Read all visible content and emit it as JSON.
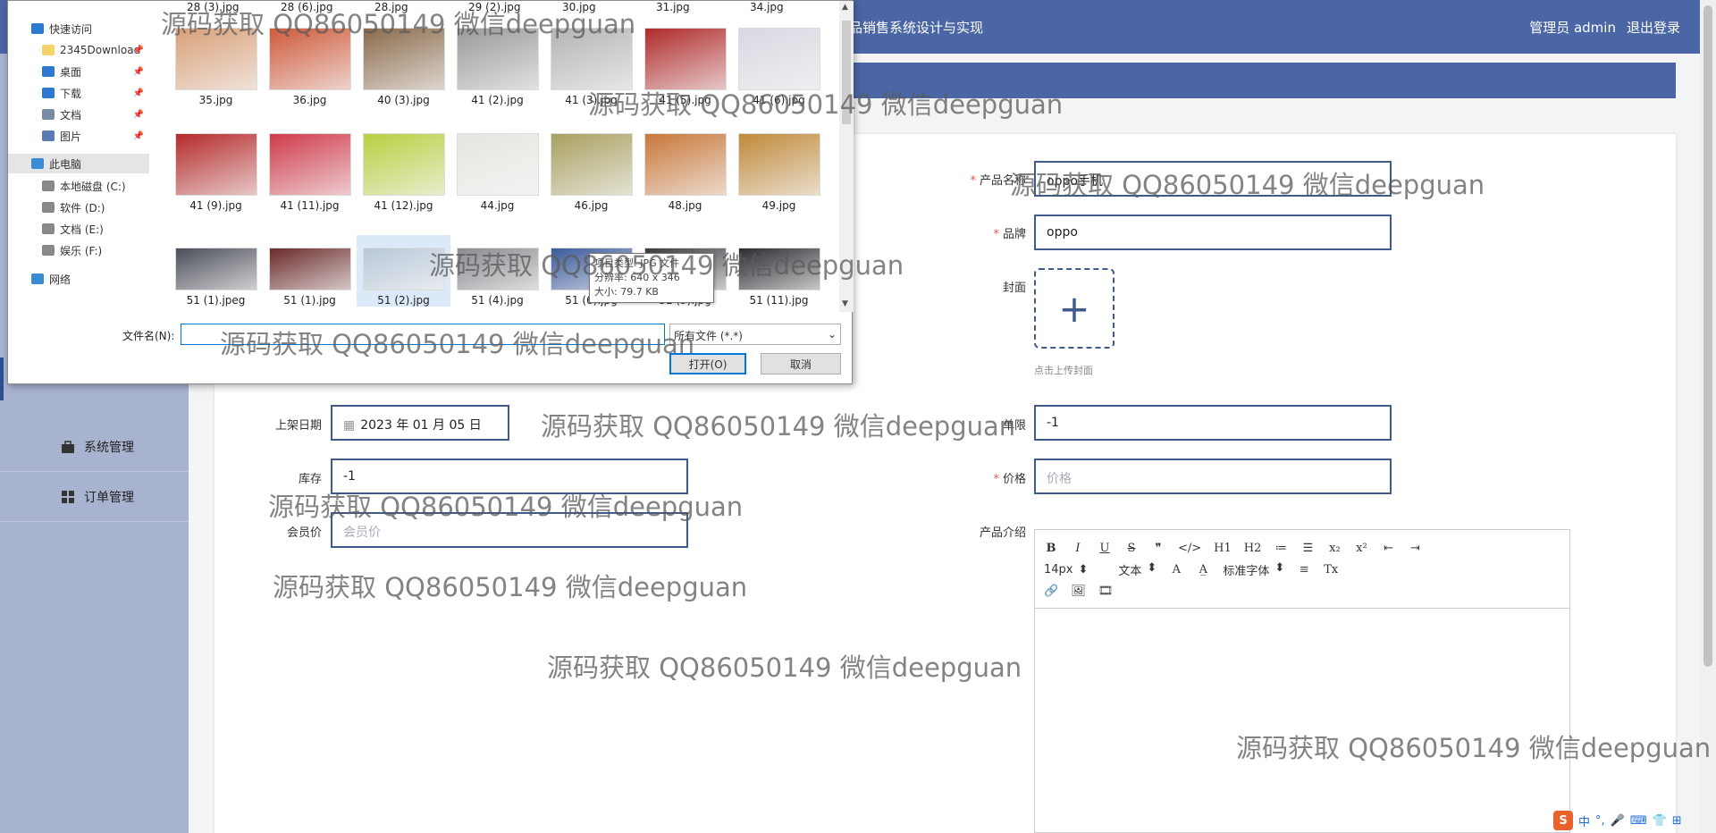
{
  "app": {
    "title_partial": "品销售系统设计与实现",
    "user": "管理员 admin",
    "logout": "退出登录"
  },
  "sidebar": {
    "items": [
      {
        "label": "系统管理",
        "icon": "briefcase-icon"
      },
      {
        "label": "订单管理",
        "icon": "grid-icon"
      }
    ]
  },
  "form": {
    "product_name": {
      "label": "产品名称",
      "value": "oppo手机"
    },
    "brand": {
      "label": "品牌",
      "value": "oppo"
    },
    "cover": {
      "label": "封面",
      "hint": "点击上传封面"
    },
    "shelf_date": {
      "label": "上架日期",
      "value": "2023 年 01 月 05 日"
    },
    "limit": {
      "label": "单限",
      "value": "-1"
    },
    "stock": {
      "label": "库存",
      "value": "-1"
    },
    "price": {
      "label": "价格",
      "placeholder": "价格"
    },
    "member_price": {
      "label": "会员价",
      "placeholder": "会员价"
    },
    "intro": {
      "label": "产品介绍"
    }
  },
  "editor": {
    "row1": [
      "B",
      "I",
      "U",
      "S",
      "❞",
      "</>",
      "H1",
      "H2",
      "≔",
      "☰",
      "x₂",
      "x²",
      "⇤",
      "⇥"
    ],
    "font_size": "14px",
    "block": "文本",
    "font": "标准字体",
    "row2_icons": [
      "A",
      "A̲",
      "≡",
      "Tx"
    ],
    "row3_icons": [
      "🔗",
      "🖼",
      "🎞"
    ]
  },
  "dialog": {
    "nav": [
      {
        "label": "快速访问",
        "icon": "star-icon",
        "pinned": false
      },
      {
        "label": "2345Download",
        "icon": "folder-icon",
        "pinned": true
      },
      {
        "label": "桌面",
        "icon": "desktop-icon",
        "pinned": true
      },
      {
        "label": "下载",
        "icon": "download-icon",
        "pinned": true
      },
      {
        "label": "文档",
        "icon": "document-icon",
        "pinned": true
      },
      {
        "label": "图片",
        "icon": "pictures-icon",
        "pinned": true
      },
      {
        "label": "此电脑",
        "icon": "computer-icon",
        "pinned": false
      },
      {
        "label": "本地磁盘 (C:)",
        "icon": "drive-icon",
        "pinned": false
      },
      {
        "label": "软件 (D:)",
        "icon": "drive-icon",
        "pinned": false
      },
      {
        "label": "文档 (E:)",
        "icon": "drive-icon",
        "pinned": false
      },
      {
        "label": "娱乐 (F:)",
        "icon": "drive-icon",
        "pinned": false
      },
      {
        "label": "网络",
        "icon": "network-icon",
        "pinned": false
      }
    ],
    "top_row": [
      "28 (3).jpg",
      "28 (6).jpg",
      "28.jpg",
      "29 (2).jpg",
      "30.jpg",
      "31.jpg",
      "34.jpg"
    ],
    "files_row1": [
      {
        "name": "35.jpg",
        "color": "#d9a078"
      },
      {
        "name": "36.jpg",
        "color": "#cf5a3a"
      },
      {
        "name": "40 (3).jpg",
        "color": "#8a6a4a"
      },
      {
        "name": "41 (2).jpg",
        "color": "#9a9a98"
      },
      {
        "name": "41 (3).jpg",
        "color": "#b4b4b4"
      },
      {
        "name": "41 (5).jpg",
        "color": "#b02a2a"
      },
      {
        "name": "41 (6).jpg",
        "color": "#d8d8e2"
      }
    ],
    "files_row2": [
      {
        "name": "41 (9).jpg",
        "color": "#b52a2a"
      },
      {
        "name": "41 (11).jpg",
        "color": "#d03a4a"
      },
      {
        "name": "41 (12).jpg",
        "color": "#b8d040"
      },
      {
        "name": "44.jpg",
        "color": "#e6e6e0"
      },
      {
        "name": "46.jpg",
        "color": "#a8a060"
      },
      {
        "name": "48.jpg",
        "color": "#c8783a"
      },
      {
        "name": "49.jpg",
        "color": "#c08a3a"
      }
    ],
    "files_row3": [
      {
        "name": "51 (1).jpeg",
        "color": "#4a4e58"
      },
      {
        "name": "51 (1).jpg",
        "color": "#6a2a2a"
      },
      {
        "name": "51 (2).jpg",
        "color": "#b8c8d8"
      },
      {
        "name": "51 (4).jpg",
        "color": "#8a8a90"
      },
      {
        "name": "51 (6).jpg",
        "color": "#3a5a9a"
      },
      {
        "name": "51 (9).jpg",
        "color": "#3a3a40"
      },
      {
        "name": "51 (11).jpg",
        "color": "#2a2a30"
      }
    ],
    "tooltip": {
      "line1": "项目类型: JPG 文件",
      "line2": "分辨率: 640 x 346",
      "line3": "大小: 79.7 KB"
    },
    "filename_label": "文件名(N):",
    "filename_value": "",
    "filter": "所有文件 (*.*)",
    "open": "打开(O)",
    "cancel": "取消"
  },
  "watermark": "源码获取 QQ86050149 微信deepguan",
  "ime": [
    "S",
    "中",
    "°,",
    "🎤",
    "⌨",
    "👕",
    "⊞"
  ]
}
